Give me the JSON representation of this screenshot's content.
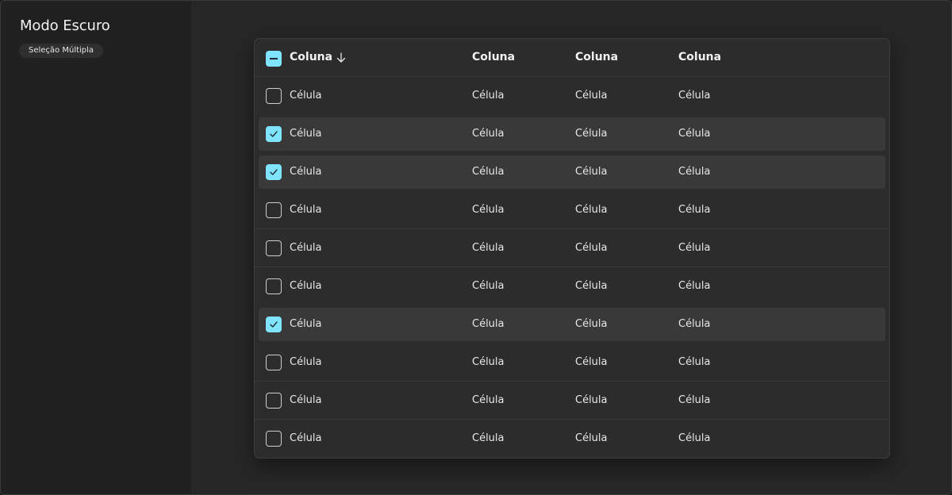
{
  "sidebar": {
    "title": "Modo Escuro",
    "badge": "Seleção Múltipla"
  },
  "table": {
    "columns": [
      "Coluna",
      "Coluna",
      "Coluna",
      "Coluna"
    ],
    "sort_icon": "arrow-down-icon",
    "header_checkbox_state": "indeterminate",
    "accent_color": "#7fe4ff",
    "rows": [
      {
        "selected": false,
        "cells": [
          "Célula",
          "Célula",
          "Célula",
          "Célula"
        ]
      },
      {
        "selected": true,
        "cells": [
          "Célula",
          "Célula",
          "Célula",
          "Célula"
        ]
      },
      {
        "selected": true,
        "cells": [
          "Célula",
          "Célula",
          "Célula",
          "Célula"
        ]
      },
      {
        "selected": false,
        "cells": [
          "Célula",
          "Célula",
          "Célula",
          "Célula"
        ]
      },
      {
        "selected": false,
        "cells": [
          "Célula",
          "Célula",
          "Célula",
          "Célula"
        ]
      },
      {
        "selected": false,
        "cells": [
          "Célula",
          "Célula",
          "Célula",
          "Célula"
        ]
      },
      {
        "selected": true,
        "cells": [
          "Célula",
          "Célula",
          "Célula",
          "Célula"
        ]
      },
      {
        "selected": false,
        "cells": [
          "Célula",
          "Célula",
          "Célula",
          "Célula"
        ]
      },
      {
        "selected": false,
        "cells": [
          "Célula",
          "Célula",
          "Célula",
          "Célula"
        ]
      },
      {
        "selected": false,
        "cells": [
          "Célula",
          "Célula",
          "Célula",
          "Célula"
        ]
      }
    ]
  }
}
